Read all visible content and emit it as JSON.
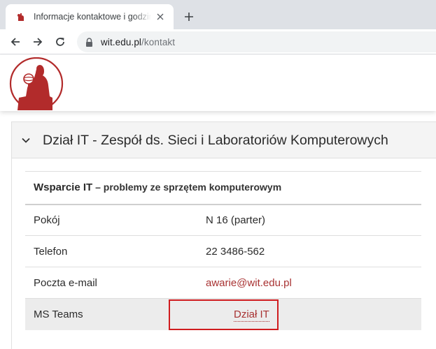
{
  "browser": {
    "tab": {
      "title": "Informacje kontaktowe i godziny"
    },
    "address": {
      "host": "wit.edu.pl",
      "path": "/kontakt"
    }
  },
  "section": {
    "title": "Dział IT - Zespół ds. Sieci i Laboratoriów Komputerowych",
    "subheading_strong": "Wsparcie IT",
    "subheading_rest": " – problemy ze sprzętem komputerowym",
    "rows": [
      {
        "label": "Pokój",
        "value": "N 16 (parter)"
      },
      {
        "label": "Telefon",
        "value": "22 3486-562"
      },
      {
        "label": "Poczta e-mail",
        "value": "awarie@wit.edu.pl"
      },
      {
        "label": "MS Teams",
        "value": "Dział IT"
      }
    ]
  },
  "colors": {
    "brand_red": "#a83232",
    "highlight_border": "#d01c1f"
  }
}
